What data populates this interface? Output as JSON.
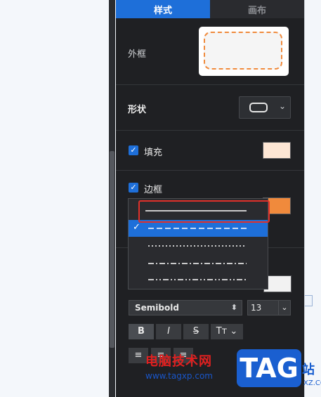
{
  "tabs": {
    "style": "样式",
    "canvas": "画布"
  },
  "frame": {
    "label": "外框"
  },
  "shape": {
    "label": "形状"
  },
  "fill": {
    "label": "填充",
    "checked": "✓",
    "color": "#fde6d4"
  },
  "border": {
    "label": "边框",
    "checked": "✓",
    "color": "#f08a3c"
  },
  "dropdown": {
    "check": "✓",
    "options": [
      "solid",
      "dashed",
      "dotted",
      "dash-dot",
      "dash-dot-dot"
    ],
    "selected_index": 1
  },
  "text": {
    "font": "Semibold",
    "size": "13",
    "bold": "B",
    "italic": "I",
    "strike": "S",
    "case": "Tт",
    "color": "#f2f2f2"
  },
  "watermark": {
    "cn": "电脑技术网",
    "url": "www.tagxp.com",
    "tag": "TAG",
    "side": "站",
    "side2": "XZ.COM"
  },
  "colors": {
    "accent": "#1e6fd9",
    "panel_bg": "#1f2023",
    "highlight": "#e0302a"
  },
  "icons": {
    "up_down": "⌃",
    "chevron": "⌄",
    "case_chevron": "⌄"
  }
}
